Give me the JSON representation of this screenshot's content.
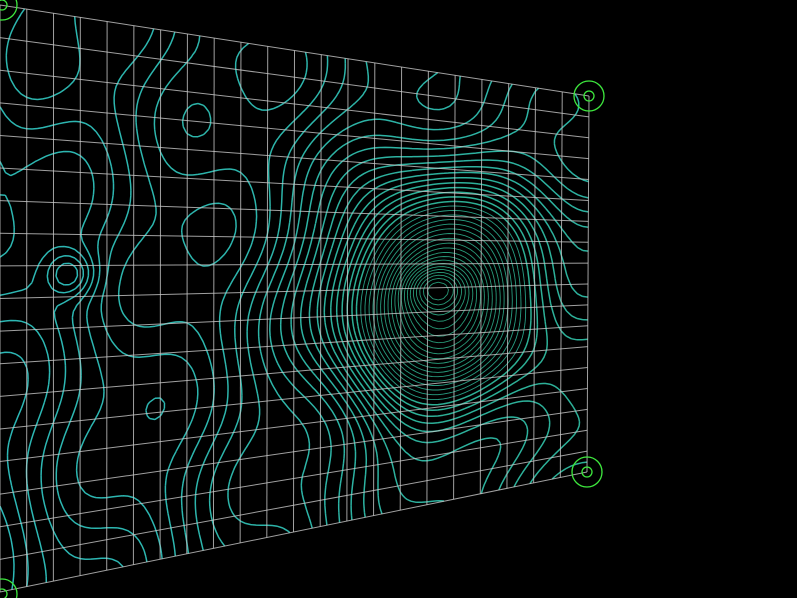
{
  "viewport": {
    "background": "#000000"
  },
  "grid": {
    "rows": 18,
    "columns": 22,
    "line_color": "#c8c8c8"
  },
  "contours": {
    "color_outer": "#2fc3c3",
    "color_inner": "#2fb48c",
    "peak_count": 1
  },
  "control_handles": {
    "color": "#3ee83e",
    "items": [
      {
        "name": "handle-top-left",
        "corner": "top-left"
      },
      {
        "name": "handle-top-right",
        "corner": "top-right"
      },
      {
        "name": "handle-bottom-right",
        "corner": "bottom-right"
      },
      {
        "name": "handle-bottom-left",
        "corner": "bottom-left"
      }
    ]
  }
}
